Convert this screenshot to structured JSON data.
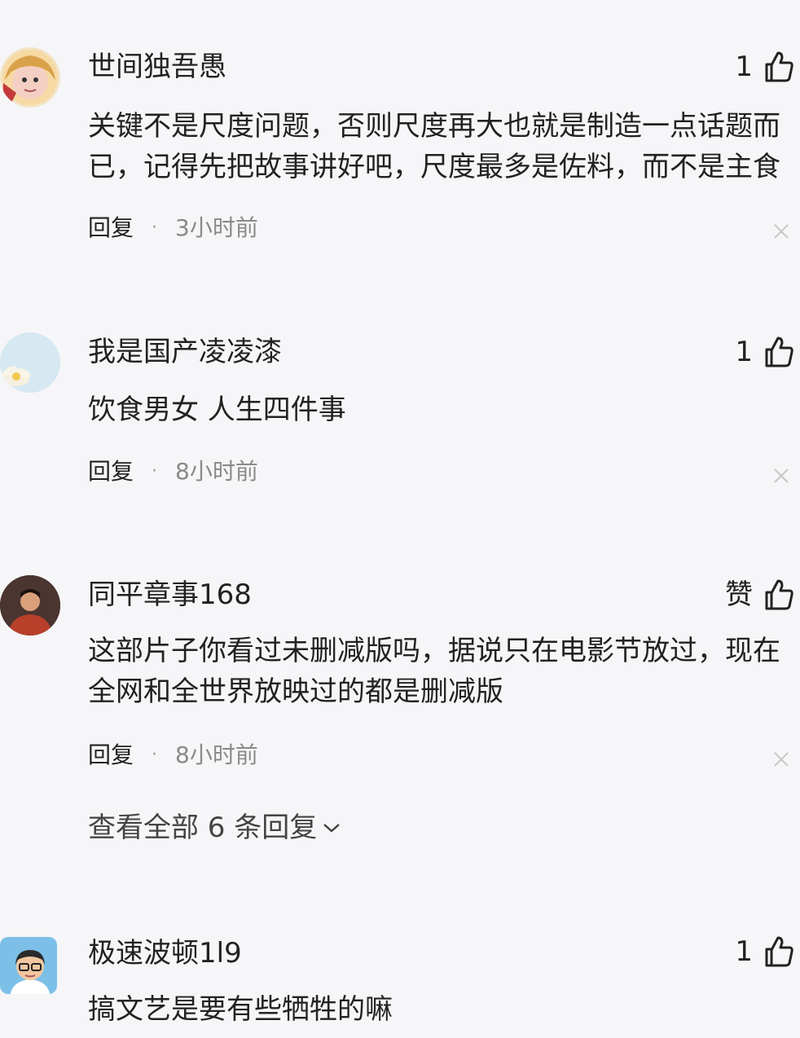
{
  "comments": [
    {
      "username": "世间独吾愚",
      "likes": "1",
      "text_lines": [
        "关键不是尺度问题，否则尺度再大也就是制造一点话题而",
        "已，记得先把故事讲好吧，尺度最多是佐料，而不是主食"
      ],
      "reply": "回复",
      "time": "3小时前"
    },
    {
      "username": "我是国产凌凌漆",
      "likes": "1",
      "text_lines": [
        "饮食男女 人生四件事"
      ],
      "reply": "回复",
      "time": "8小时前"
    },
    {
      "username": "同平章事168",
      "likes": "赞",
      "text_lines": [
        "这部片子你看过未删减版吗，据说只在电影节放过，现在",
        "全网和全世界放映过的都是删减版"
      ],
      "reply": "回复",
      "time": "8小时前",
      "view_replies": "查看全部 6 条回复"
    },
    {
      "username": "极速波顿1l9",
      "likes": "1",
      "text_lines": [
        "搞文艺是要有些牺牲的嘛"
      ]
    }
  ]
}
